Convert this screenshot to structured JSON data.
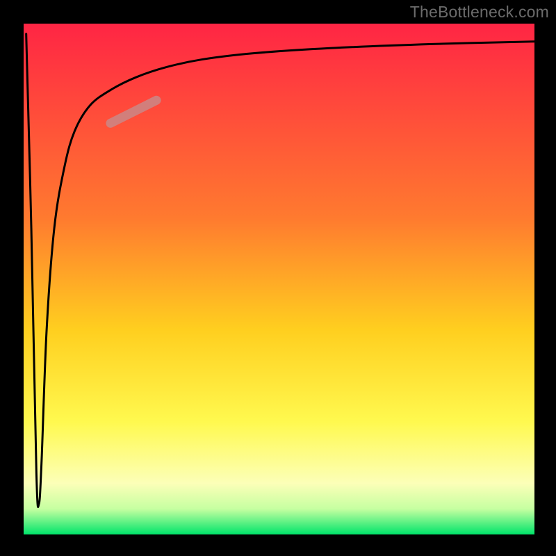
{
  "attribution": "TheBottleneck.com",
  "chart_data": {
    "type": "line",
    "title": "",
    "xlabel": "",
    "ylabel": "",
    "xlim": [
      0,
      100
    ],
    "ylim": [
      0,
      100
    ],
    "grid": false,
    "legend": false,
    "background_gradient": [
      "#ff2544",
      "#ff9a2f",
      "#ffe92c",
      "#fcff7a",
      "#00e46a"
    ],
    "series": [
      {
        "name": "main-curve",
        "color": "#000000",
        "x": [
          0.5,
          1.5,
          2.5,
          3.0,
          3.5,
          4.5,
          6.0,
          8.0,
          10.0,
          13.0,
          17.0,
          22.0,
          28.0,
          35.0,
          45.0,
          60.0,
          80.0,
          100.0
        ],
        "y": [
          98,
          60,
          12,
          6,
          14,
          40,
          60,
          72,
          79,
          84,
          87,
          89.5,
          91.5,
          93,
          94.2,
          95.2,
          96,
          96.5
        ]
      },
      {
        "name": "highlight-segment",
        "color": "#c88a8a",
        "x": [
          17.0,
          26.0
        ],
        "y": [
          80.5,
          85.0
        ]
      }
    ],
    "note": "All values are estimated from the raster image. Axes are unlabeled; ranges 0-100 are assumed for readability."
  }
}
